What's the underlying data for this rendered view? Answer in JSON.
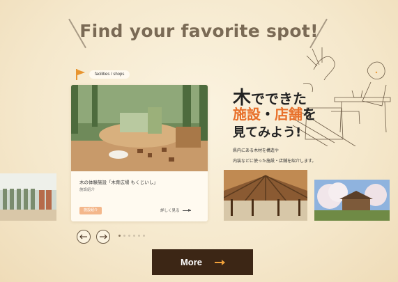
{
  "heading": "Find your favorite spot!",
  "category": {
    "label": "facilities / shops",
    "icon": "flag-icon"
  },
  "featured_card": {
    "title": "木の体験施設「木育広場 もくじいし」",
    "subtitle": "施設紹介",
    "badge": "施設紹介",
    "link_label": "詳しく見る"
  },
  "promo": {
    "line1_big": "木",
    "line1_rest": "でできた",
    "line2_a": "施設",
    "line2_sep": "・",
    "line2_b": "店舗",
    "line2_end": "を",
    "line3": "見てみよう!",
    "body1": "県内にある木材を構造や",
    "body2": "内装などに使った施設・店舗を紹介します。"
  },
  "carousel": {
    "prev_icon": "arrow-left-icon",
    "next_icon": "arrow-right-icon",
    "dot_count": 6,
    "active_dot": 0
  },
  "more_button": {
    "label": "More"
  },
  "colors": {
    "background": "#f6ecd3",
    "accent": "#e8702a",
    "button": "#3c2615",
    "arrow": "#f2a23a"
  }
}
